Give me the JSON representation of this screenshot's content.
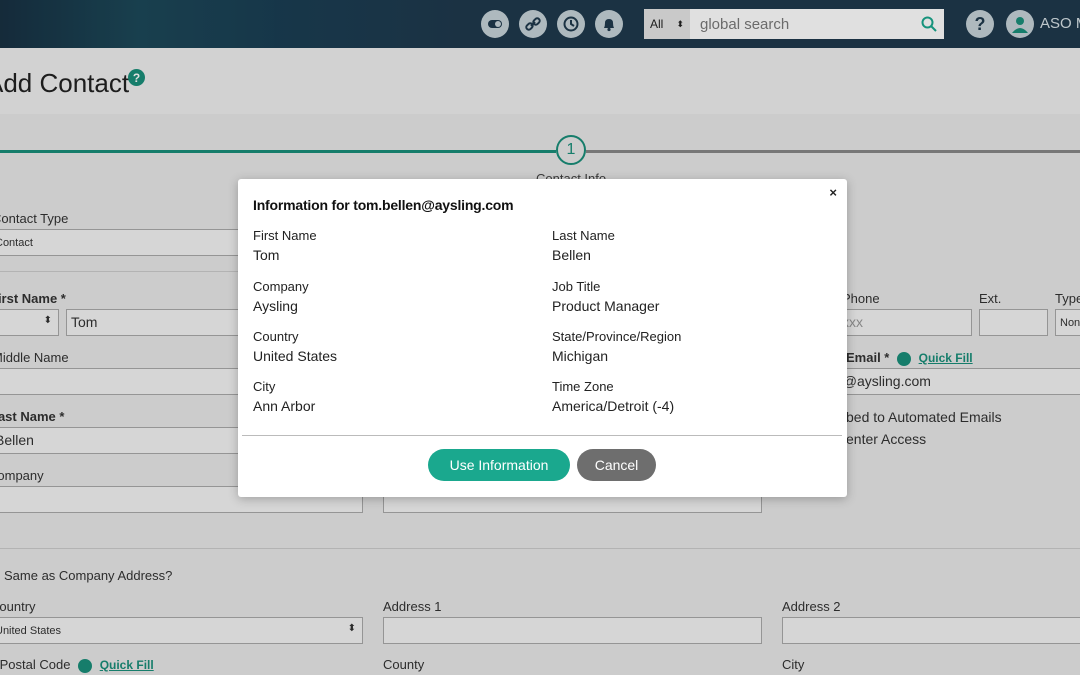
{
  "topbar": {
    "scope_value": "All",
    "search_placeholder": "global search",
    "help_label": "?",
    "user_name": "ASO M"
  },
  "page": {
    "title": "Add Contact",
    "help_label": "?",
    "step_number": "1",
    "step_label": "Contact Info"
  },
  "form": {
    "contact_type_label": "Contact Type",
    "contact_type_value": "Contact",
    "first_name_label": "First Name *",
    "first_name_prefix": "-",
    "first_name_value": "Tom",
    "middle_name_label": "Middle Name",
    "last_name_label": "Last Name *",
    "last_name_value": "Bellen",
    "company_label": "Company",
    "phone_label": "Phone",
    "phone_placeholder": "xxxx",
    "ext_label": "Ext.",
    "type_label": "Type",
    "type_value": "Non",
    "email_label": "Email *",
    "quick_fill": "Quick Fill",
    "email_value": "n@aysling.com",
    "subscribed_label": "bed to Automated Emails",
    "center_access_label": "enter Access",
    "same_as_company": "Same as Company Address?",
    "country_label": "Country",
    "country_value": "United States",
    "address1_label": "Address 1",
    "address2_label": "Address 2",
    "postal_label": "/Postal Code",
    "county_label": "County",
    "city_label": "City"
  },
  "modal": {
    "close_label": "×",
    "title": "Information for tom.bellen@aysling.com",
    "fields": [
      {
        "label": "First Name",
        "value": "Tom"
      },
      {
        "label": "Last Name",
        "value": "Bellen"
      },
      {
        "label": "Company",
        "value": "Aysling"
      },
      {
        "label": "Job Title",
        "value": "Product Manager"
      },
      {
        "label": "Country",
        "value": "United States"
      },
      {
        "label": "State/Province/Region",
        "value": "Michigan"
      },
      {
        "label": "City",
        "value": "Ann Arbor"
      },
      {
        "label": "Time Zone",
        "value": "America/Detroit (-4)"
      }
    ],
    "use_button": "Use Information",
    "cancel_button": "Cancel"
  },
  "colors": {
    "topbar": "#1f3a4d",
    "accent": "#1aa88e",
    "cancel": "#6e6e6e"
  }
}
